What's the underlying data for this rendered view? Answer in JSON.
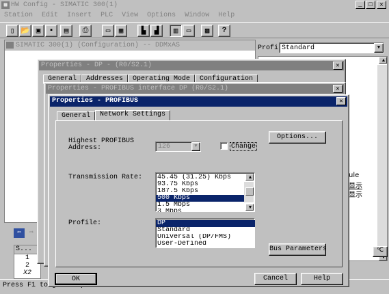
{
  "app": {
    "title": "HW Config - SIMATIC 300(1)",
    "menu": [
      "Station",
      "Edit",
      "Insert",
      "PLC",
      "View",
      "Options",
      "Window",
      "Help"
    ]
  },
  "toolbar": {
    "icons": [
      "new-icon",
      "open-icon",
      "save-compile-icon",
      "save-icon",
      "download-icon",
      "print-icon",
      "copy-icon",
      "paste-icon",
      "catalog-icon",
      "network-icon",
      "view-icon",
      "split-view-icon",
      "config-icon",
      "help-icon"
    ]
  },
  "child_window": {
    "title": "SIMATIC 300(1) (Configuration) -- DDMxAS"
  },
  "catalog": {
    "profile_label": "Profi",
    "profile_value": "Standard",
    "side_texts": [
      "ule",
      "显示",
      "显示"
    ]
  },
  "dialog_dp": {
    "title": "Properties - DP - (R0/S2.1)",
    "tabs": [
      "General",
      "Addresses",
      "Operating Mode",
      "Configuration"
    ]
  },
  "dialog_interface": {
    "title": "Properties - PROFIBUS interface  DP (R0/S2.1)"
  },
  "dialog_profibus": {
    "title": "Properties - PROFIBUS",
    "tabs": [
      "General",
      "Network Settings"
    ],
    "highest_address_label_1": "Highest PROFIBUS",
    "highest_address_label_2": "Address:",
    "highest_address_value": "126",
    "change_label": "Change",
    "options_button": "Options...",
    "transmission_rate_label": "Transmission Rate:",
    "transmission_rates": [
      "45.45 (31.25) Kbps",
      "93.75 Kbps",
      "187.5 Kbps",
      "500 Kbps",
      "1.5 Mbps",
      "3 Mbps"
    ],
    "selected_rate": "500 Kbps",
    "profile_label": "Profile:",
    "profiles": [
      "DP",
      "Standard",
      "Universal (DP/FMS)",
      "User-Defined"
    ],
    "selected_profile": "DP",
    "bus_parameters_button": "Bus Parameters...",
    "ok_button": "OK",
    "cancel_button": "Cancel",
    "help_button": "Help"
  },
  "bottom_table": {
    "header": "S...",
    "rows": [
      "1",
      "2",
      "X2"
    ]
  },
  "status_bar": {
    "text": "Press F1 to get Help."
  },
  "colors": {
    "active_title": "#0a246a",
    "inactive_title": "#808080",
    "face": "#c0c0c0"
  }
}
